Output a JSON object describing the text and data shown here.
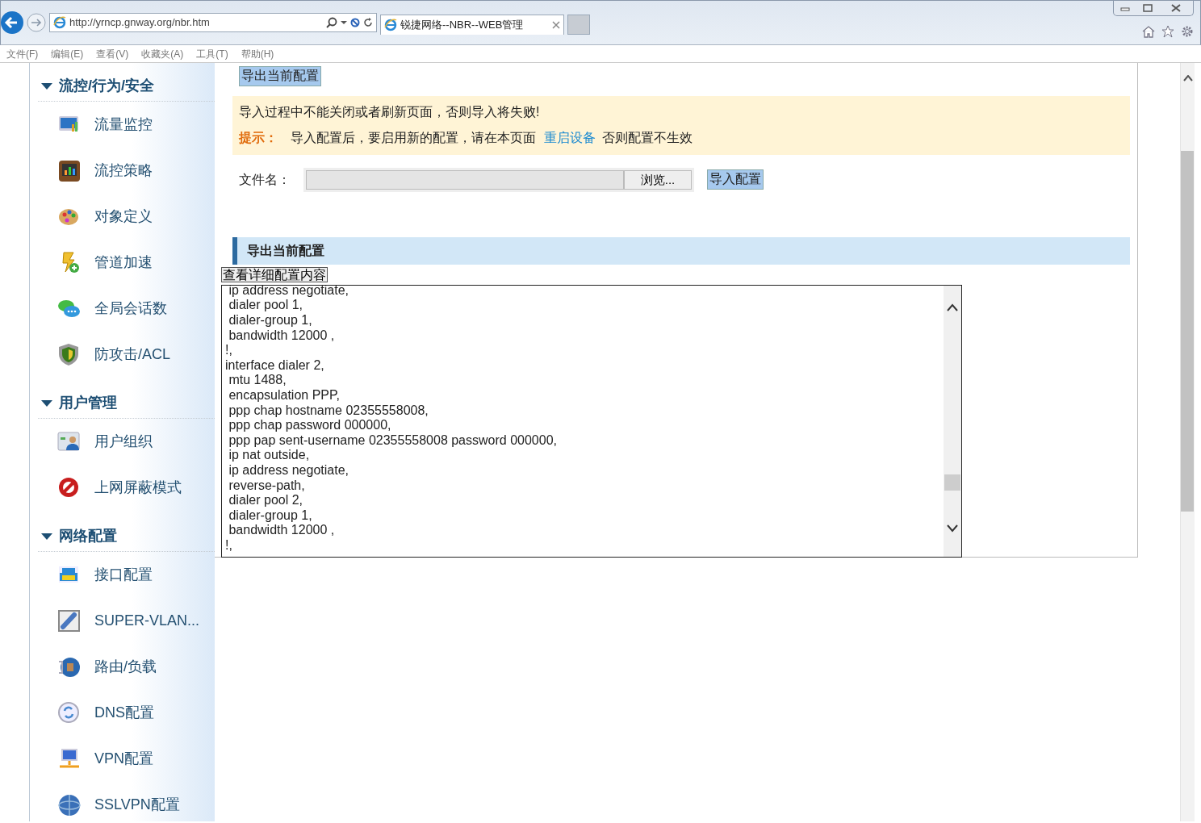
{
  "browser": {
    "url": "http://yrncp.gnway.org/nbr.htm",
    "tab_title": "锐捷网络--NBR--WEB管理",
    "menu": [
      "文件(F)",
      "编辑(E)",
      "查看(V)",
      "收藏夹(A)",
      "工具(T)",
      "帮助(H)"
    ]
  },
  "sidebar": {
    "sections": [
      {
        "title": "流控/行为/安全",
        "expanded": true,
        "items": [
          {
            "label": "流量监控",
            "kind": "monitor"
          },
          {
            "label": "流控策略",
            "kind": "board"
          },
          {
            "label": "对象定义",
            "kind": "palette"
          },
          {
            "label": "管道加速",
            "kind": "bolt"
          },
          {
            "label": "全局会话数",
            "kind": "chat"
          },
          {
            "label": "防攻击/ACL",
            "kind": "shield"
          }
        ]
      },
      {
        "title": "用户管理",
        "expanded": true,
        "items": [
          {
            "label": "用户组织",
            "kind": "users"
          },
          {
            "label": "上网屏蔽模式",
            "kind": "forbidden"
          }
        ]
      },
      {
        "title": "网络配置",
        "expanded": true,
        "items": [
          {
            "label": "接口配置",
            "kind": "port"
          },
          {
            "label": "SUPER-VLAN...",
            "kind": "plug"
          },
          {
            "label": "路由/负载",
            "kind": "router"
          },
          {
            "label": "DNS配置",
            "kind": "refresh"
          },
          {
            "label": "VPN配置",
            "kind": "computer"
          },
          {
            "label": "SSLVPN配置",
            "kind": "globe"
          }
        ]
      }
    ]
  },
  "content": {
    "export_button": "导出当前配置",
    "notice": {
      "warning": "导入过程中不能关闭或者刷新页面，否则导入将失败!",
      "tip_label": "提示：",
      "tip_text": "导入配置后，要启用新的配置，请在本页面",
      "link": "重启设备",
      "tip_suffix": "否则配置不生效"
    },
    "file_label": "文件名：",
    "browse_button": "浏览...",
    "import_button": "导入配置",
    "section_title": "导出当前配置",
    "view_button": "查看详细配置内容",
    "config_lines": [
      " ip address negotiate,",
      " dialer pool 1,",
      " dialer-group 1,",
      " bandwidth 12000 ,",
      "!,",
      "interface dialer 2,",
      " mtu 1488,",
      " encapsulation PPP,",
      " ppp chap hostname 02355558008,",
      " ppp chap password 000000,",
      " ppp pap sent-username 02355558008 password 000000,",
      " ip nat outside,",
      " ip address negotiate,",
      " reverse-path,",
      " dialer pool 2,",
      " dialer-group 1,",
      " bandwidth 12000 ,",
      "!,"
    ]
  }
}
